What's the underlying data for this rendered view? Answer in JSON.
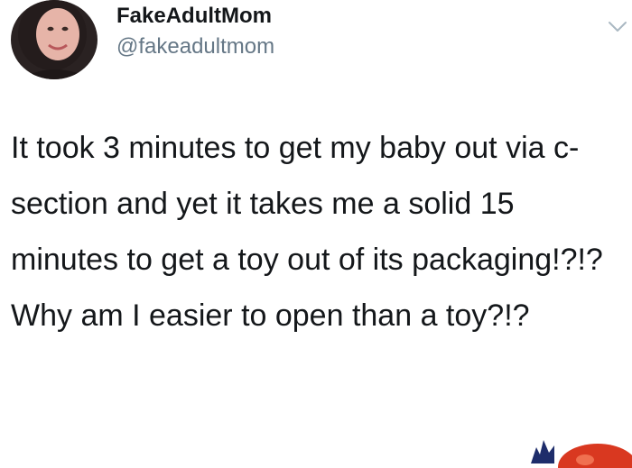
{
  "tweet": {
    "display_name": "FakeAdultMom",
    "handle": "@fakeadultmom",
    "paragraphs": [
      "It took 3 minutes to get my baby out via c-section and yet it takes me a solid 15 minutes to get a toy out of its packaging!?!?",
      "Why am I easier to open than a toy?!?"
    ]
  },
  "icons": {
    "menu": "chevron-down-icon",
    "avatar": "avatar"
  },
  "colors": {
    "name": "#14171a",
    "handle": "#657786",
    "chevron": "#aab8c2"
  }
}
